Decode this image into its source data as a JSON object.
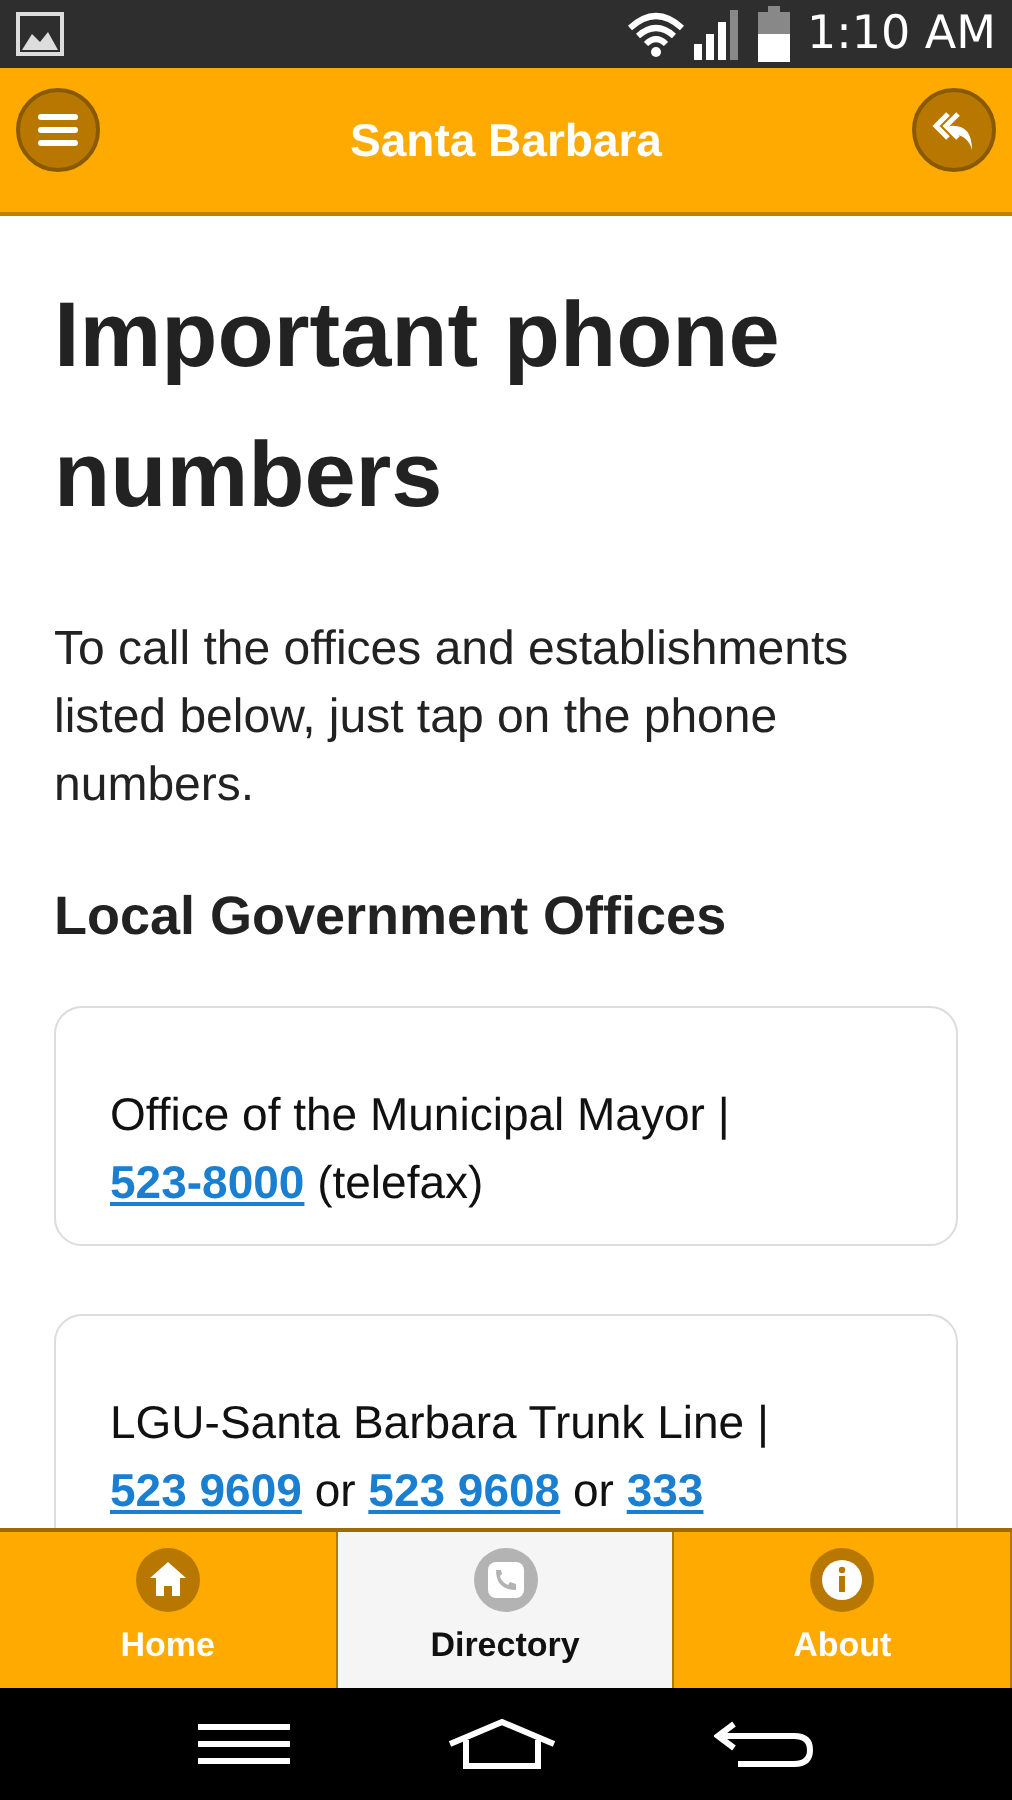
{
  "status_bar": {
    "time": "1:10 AM"
  },
  "header": {
    "title": "Santa Barbara"
  },
  "page": {
    "title": "Important phone numbers",
    "intro": "To call the offices and establishments listed below, just tap on the phone numbers.",
    "section": "Local Government Offices",
    "entries": [
      {
        "parts": [
          {
            "kind": "text",
            "text": "Office of the Municipal Mayor | "
          },
          {
            "kind": "phone",
            "text": "523-8000"
          },
          {
            "kind": "text",
            "text": " (telefax)"
          }
        ]
      },
      {
        "parts": [
          {
            "kind": "text",
            "text": "LGU-Santa Barbara Trunk Line | "
          },
          {
            "kind": "phone",
            "text": "523 9609"
          },
          {
            "kind": "text",
            "text": " or "
          },
          {
            "kind": "phone",
            "text": "523 9608"
          },
          {
            "kind": "text",
            "text": " or "
          },
          {
            "kind": "phone",
            "text": "333"
          }
        ]
      }
    ]
  },
  "tabs": [
    {
      "label": "Home",
      "kind": "home",
      "selected": false
    },
    {
      "label": "Directory",
      "kind": "phone",
      "selected": true
    },
    {
      "label": "About",
      "kind": "info",
      "selected": false
    }
  ]
}
